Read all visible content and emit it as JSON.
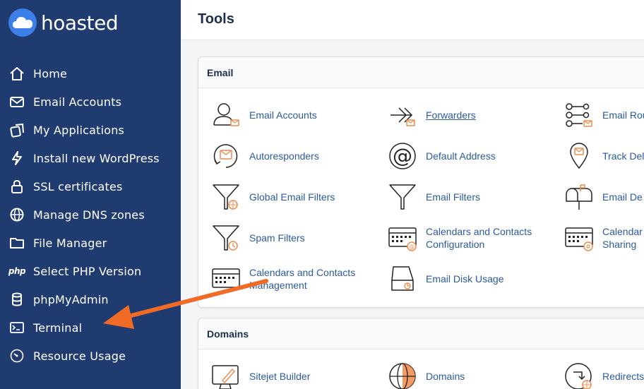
{
  "brand": {
    "name": "hoasted"
  },
  "sidebar": {
    "items": [
      {
        "label": "Home",
        "icon": "home-icon"
      },
      {
        "label": "Email Accounts",
        "icon": "mail-icon"
      },
      {
        "label": "My Applications",
        "icon": "applications-icon"
      },
      {
        "label": "Install new WordPress",
        "icon": "bolt-icon"
      },
      {
        "label": "SSL certificates",
        "icon": "lock-icon"
      },
      {
        "label": "Manage DNS zones",
        "icon": "globe-icon"
      },
      {
        "label": "File Manager",
        "icon": "folder-icon"
      },
      {
        "label": "Select PHP Version",
        "icon": "php-icon",
        "glyph": "php"
      },
      {
        "label": "phpMyAdmin",
        "icon": "database-icon"
      },
      {
        "label": "Terminal",
        "icon": "terminal-icon"
      },
      {
        "label": "Resource Usage",
        "icon": "gauge-icon"
      }
    ]
  },
  "main": {
    "title": "Tools",
    "sections": [
      {
        "title": "Email",
        "tools": [
          {
            "label": "Email Accounts",
            "icon": "user-mail-icon"
          },
          {
            "label": "Forwarders",
            "icon": "forward-icon"
          },
          {
            "label": "Email Rou",
            "icon": "routing-icon"
          },
          {
            "label": "Autoresponders",
            "icon": "autoresponder-icon"
          },
          {
            "label": "Default Address",
            "icon": "at-icon"
          },
          {
            "label": "Track Del",
            "icon": "map-pin-mail-icon"
          },
          {
            "label": "Global Email Filters",
            "icon": "global-filter-icon"
          },
          {
            "label": "Email Filters",
            "icon": "filter-icon"
          },
          {
            "label": "Email De",
            "icon": "mailbox-icon"
          },
          {
            "label": "Spam Filters",
            "icon": "spam-filter-icon"
          },
          {
            "label": "Calendars and Contacts Configuration",
            "label_line1": "Calendars and Contacts",
            "label_line2": "Configuration",
            "icon": "calendar-config-icon"
          },
          {
            "label": "Calendar Sharing",
            "label_line1": "Calendar",
            "label_line2": "Sharing",
            "icon": "calendar-sharing-icon"
          },
          {
            "label": "Calendars and Contacts Management",
            "label_line1": "Calendars and Contacts",
            "label_line2": "Management",
            "icon": "calendar-management-icon"
          },
          {
            "label": "Email Disk Usage",
            "icon": "disk-usage-icon"
          }
        ]
      },
      {
        "title": "Domains",
        "tools": [
          {
            "label": "Sitejet Builder",
            "icon": "sitejet-icon"
          },
          {
            "label": "Domains",
            "icon": "domains-globe-icon"
          },
          {
            "label": "Redirects",
            "icon": "redirects-icon"
          }
        ]
      }
    ]
  },
  "colors": {
    "sidebar": "#1f3b6f",
    "accent": "#3d7fe8",
    "link": "#2a5aa0",
    "annotation_arrow": "#f06b26",
    "icon_orange": "#f08a4b"
  }
}
